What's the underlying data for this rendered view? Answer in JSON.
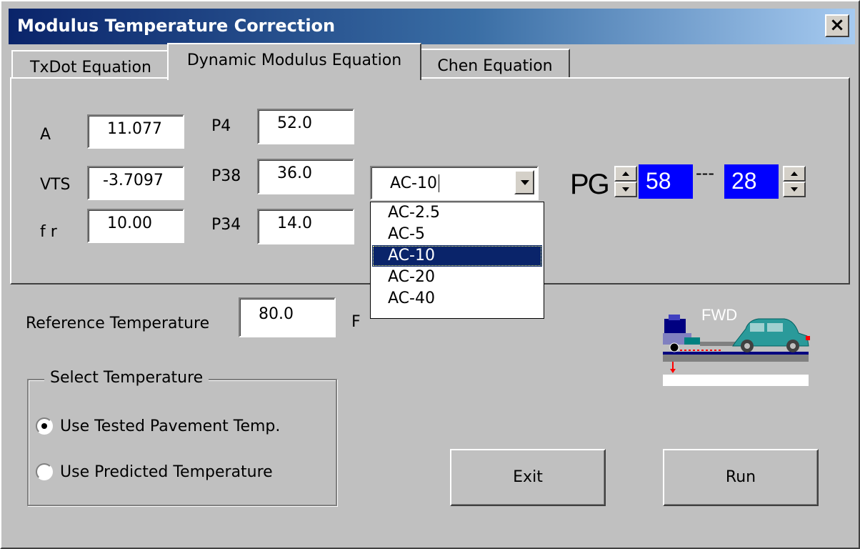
{
  "window": {
    "title": "Modulus Temperature Correction",
    "close_symbol": "×"
  },
  "tabs": [
    {
      "label": "TxDot Equation"
    },
    {
      "label": "Dynamic Modulus Equation"
    },
    {
      "label": "Chen  Equation"
    }
  ],
  "params": {
    "a_label": "A",
    "a_value": "11.077",
    "vts_label": "VTS",
    "vts_value": "-3.7097",
    "fr_label": "f r",
    "fr_value": "10.00",
    "p4_label": "P4",
    "p4_value": "52.0",
    "p38_label": "P38",
    "p38_value": "36.0",
    "p34_label": "P34",
    "p34_value": "14.0"
  },
  "binder": {
    "selected": "AC-10",
    "options": [
      "AC-2.5",
      "AC-5",
      "AC-10",
      "AC-20",
      "AC-40"
    ]
  },
  "pg": {
    "label": "PG",
    "high": "58",
    "separator": "---",
    "low": "28",
    "box_color": "#0000ff"
  },
  "reference": {
    "label": "Reference Temperature",
    "value": "80.0",
    "unit": "F"
  },
  "select_temperature": {
    "title": "Select  Temperature",
    "option_tested": "Use Tested Pavement Temp.",
    "option_predicted": "Use Predicted Temperature",
    "selected": "tested"
  },
  "buttons": {
    "exit": "Exit",
    "run": "Run"
  },
  "fwd_image": {
    "label": "FWD"
  }
}
